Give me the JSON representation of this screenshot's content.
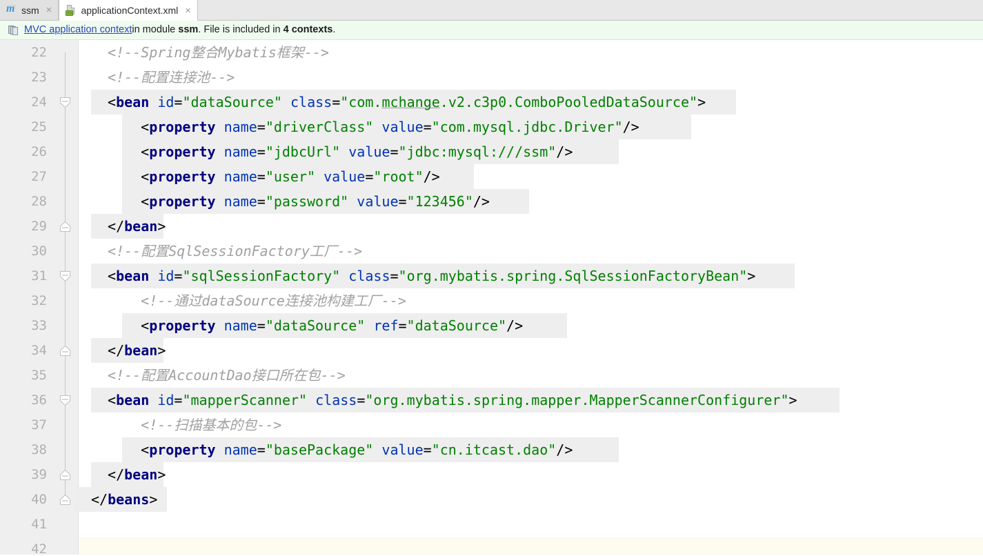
{
  "window": {
    "tabs": [
      {
        "label": "ssm",
        "icon": "module-icon",
        "active": false,
        "closable": true
      },
      {
        "label": "applicationContext.xml",
        "icon": "xml-file-icon",
        "active": true,
        "closable": true
      }
    ],
    "close_glyph": "×"
  },
  "notification": {
    "icon": "contexts-icon",
    "link_text": "MVC application context",
    "text_mid_1": "in module ",
    "module_name": "ssm",
    "text_mid_2": ". File is included in ",
    "context_count": "4 contexts",
    "text_end": ".",
    "background_color": "#effbef",
    "link_color": "#2648b8"
  },
  "editor": {
    "colors": {
      "tag": "#000080",
      "attribute": "#0033b3",
      "value": "#008000",
      "comment": "#a0a0a0",
      "highlight_background": "#eeeeee",
      "current_line_background": "#fefbef",
      "gutter_background": "#efefef",
      "line_number_color": "#b0b0b0"
    },
    "first_line_number": 22,
    "line_height": 36,
    "lines": [
      {
        "num": 22,
        "indent": 2,
        "fold": null,
        "highlight": false,
        "tokens": [
          {
            "t": "comment",
            "s": "<!--Spring整合Mybatis框架-->"
          }
        ]
      },
      {
        "num": 23,
        "indent": 2,
        "fold": null,
        "highlight": false,
        "tokens": [
          {
            "t": "comment",
            "s": "<!--配置连接池-->"
          }
        ]
      },
      {
        "num": 24,
        "indent": 2,
        "fold": "open-start",
        "highlight": true,
        "hl_width": 935,
        "tokens": [
          {
            "t": "punct",
            "s": "<"
          },
          {
            "t": "tag",
            "s": "bean"
          },
          {
            "t": "plain",
            "s": " "
          },
          {
            "t": "attr",
            "s": "id"
          },
          {
            "t": "punct",
            "s": "="
          },
          {
            "t": "val",
            "s": "\"dataSource\""
          },
          {
            "t": "plain",
            "s": " "
          },
          {
            "t": "attr",
            "s": "class"
          },
          {
            "t": "punct",
            "s": "="
          },
          {
            "t": "val",
            "s": "\"com."
          },
          {
            "t": "val-spell",
            "s": "mchange"
          },
          {
            "t": "val",
            "s": ".v2.c3p0.ComboPooledDataSource\""
          },
          {
            "t": "punct",
            "s": ">"
          }
        ]
      },
      {
        "num": 25,
        "indent": 6,
        "fold": null,
        "highlight": true,
        "hl_off": 45,
        "hl_width": 825,
        "tokens": [
          {
            "t": "punct",
            "s": "<"
          },
          {
            "t": "tag",
            "s": "property"
          },
          {
            "t": "plain",
            "s": " "
          },
          {
            "t": "attr",
            "s": "name"
          },
          {
            "t": "punct",
            "s": "="
          },
          {
            "t": "val",
            "s": "\"driverClass\""
          },
          {
            "t": "plain",
            "s": " "
          },
          {
            "t": "attr",
            "s": "value"
          },
          {
            "t": "punct",
            "s": "="
          },
          {
            "t": "val",
            "s": "\"com.mysql.jdbc.Driver\""
          },
          {
            "t": "punct",
            "s": "/>"
          }
        ]
      },
      {
        "num": 26,
        "indent": 6,
        "fold": null,
        "highlight": true,
        "hl_off": 45,
        "hl_width": 720,
        "tokens": [
          {
            "t": "punct",
            "s": "<"
          },
          {
            "t": "tag",
            "s": "property"
          },
          {
            "t": "plain",
            "s": " "
          },
          {
            "t": "attr",
            "s": "name"
          },
          {
            "t": "punct",
            "s": "="
          },
          {
            "t": "val",
            "s": "\"jdbcUrl\""
          },
          {
            "t": "plain",
            "s": " "
          },
          {
            "t": "attr",
            "s": "value"
          },
          {
            "t": "punct",
            "s": "="
          },
          {
            "t": "val",
            "s": "\"jdbc:mysql:///ssm\""
          },
          {
            "t": "punct",
            "s": "/>"
          }
        ]
      },
      {
        "num": 27,
        "indent": 6,
        "fold": null,
        "highlight": true,
        "hl_off": 45,
        "hl_width": 510,
        "tokens": [
          {
            "t": "punct",
            "s": "<"
          },
          {
            "t": "tag",
            "s": "property"
          },
          {
            "t": "plain",
            "s": " "
          },
          {
            "t": "attr",
            "s": "name"
          },
          {
            "t": "punct",
            "s": "="
          },
          {
            "t": "val",
            "s": "\"user\""
          },
          {
            "t": "plain",
            "s": " "
          },
          {
            "t": "attr",
            "s": "value"
          },
          {
            "t": "punct",
            "s": "="
          },
          {
            "t": "val",
            "s": "\"root\""
          },
          {
            "t": "punct",
            "s": "/>"
          }
        ]
      },
      {
        "num": 28,
        "indent": 6,
        "fold": null,
        "highlight": true,
        "hl_off": 45,
        "hl_width": 590,
        "tokens": [
          {
            "t": "punct",
            "s": "<"
          },
          {
            "t": "tag",
            "s": "property"
          },
          {
            "t": "plain",
            "s": " "
          },
          {
            "t": "attr",
            "s": "name"
          },
          {
            "t": "punct",
            "s": "="
          },
          {
            "t": "val",
            "s": "\"password\""
          },
          {
            "t": "plain",
            "s": " "
          },
          {
            "t": "attr",
            "s": "value"
          },
          {
            "t": "punct",
            "s": "="
          },
          {
            "t": "val",
            "s": "\"123456\""
          },
          {
            "t": "punct",
            "s": "/>"
          }
        ]
      },
      {
        "num": 29,
        "indent": 2,
        "fold": "open-end",
        "highlight": true,
        "hl_width": 105,
        "tokens": [
          {
            "t": "punct",
            "s": "</"
          },
          {
            "t": "tag",
            "s": "bean"
          },
          {
            "t": "punct",
            "s": ">"
          }
        ]
      },
      {
        "num": 30,
        "indent": 2,
        "fold": null,
        "highlight": false,
        "tokens": [
          {
            "t": "comment",
            "s": "<!--配置SqlSessionFactory工厂-->"
          }
        ]
      },
      {
        "num": 31,
        "indent": 2,
        "fold": "open-start",
        "highlight": true,
        "hl_width": 1020,
        "tokens": [
          {
            "t": "punct",
            "s": "<"
          },
          {
            "t": "tag",
            "s": "bean"
          },
          {
            "t": "plain",
            "s": " "
          },
          {
            "t": "attr",
            "s": "id"
          },
          {
            "t": "punct",
            "s": "="
          },
          {
            "t": "val",
            "s": "\"sqlSessionFactory\""
          },
          {
            "t": "plain",
            "s": " "
          },
          {
            "t": "attr",
            "s": "class"
          },
          {
            "t": "punct",
            "s": "="
          },
          {
            "t": "val",
            "s": "\"org.mybatis.spring.SqlSessionFactoryBean\""
          },
          {
            "t": "punct",
            "s": ">"
          }
        ]
      },
      {
        "num": 32,
        "indent": 6,
        "fold": null,
        "highlight": false,
        "tokens": [
          {
            "t": "comment",
            "s": "<!--通过dataSource连接池构建工厂-->"
          }
        ]
      },
      {
        "num": 33,
        "indent": 6,
        "fold": null,
        "highlight": true,
        "hl_off": 45,
        "hl_width": 645,
        "tokens": [
          {
            "t": "punct",
            "s": "<"
          },
          {
            "t": "tag",
            "s": "property"
          },
          {
            "t": "plain",
            "s": " "
          },
          {
            "t": "attr",
            "s": "name"
          },
          {
            "t": "punct",
            "s": "="
          },
          {
            "t": "val",
            "s": "\"dataSource\""
          },
          {
            "t": "plain",
            "s": " "
          },
          {
            "t": "attr",
            "s": "ref"
          },
          {
            "t": "punct",
            "s": "="
          },
          {
            "t": "val",
            "s": "\"dataSource\""
          },
          {
            "t": "punct",
            "s": "/>"
          }
        ]
      },
      {
        "num": 34,
        "indent": 2,
        "fold": "open-end",
        "highlight": true,
        "hl_width": 105,
        "tokens": [
          {
            "t": "punct",
            "s": "</"
          },
          {
            "t": "tag",
            "s": "bean"
          },
          {
            "t": "punct",
            "s": ">"
          }
        ]
      },
      {
        "num": 35,
        "indent": 2,
        "fold": null,
        "highlight": false,
        "tokens": [
          {
            "t": "comment",
            "s": "<!--配置AccountDao接口所在包-->"
          }
        ]
      },
      {
        "num": 36,
        "indent": 2,
        "fold": "open-start",
        "highlight": true,
        "hl_width": 1085,
        "tokens": [
          {
            "t": "punct",
            "s": "<"
          },
          {
            "t": "tag",
            "s": "bean"
          },
          {
            "t": "plain",
            "s": " "
          },
          {
            "t": "attr",
            "s": "id"
          },
          {
            "t": "punct",
            "s": "="
          },
          {
            "t": "val",
            "s": "\"mapperScanner\""
          },
          {
            "t": "plain",
            "s": " "
          },
          {
            "t": "attr",
            "s": "class"
          },
          {
            "t": "punct",
            "s": "="
          },
          {
            "t": "val",
            "s": "\"org.mybatis.spring.mapper.MapperScannerConfigurer\""
          },
          {
            "t": "punct",
            "s": ">"
          }
        ]
      },
      {
        "num": 37,
        "indent": 6,
        "fold": null,
        "highlight": false,
        "tokens": [
          {
            "t": "comment",
            "s": "<!--扫描基本的包-->"
          }
        ]
      },
      {
        "num": 38,
        "indent": 6,
        "fold": null,
        "highlight": true,
        "hl_off": 45,
        "hl_width": 720,
        "tokens": [
          {
            "t": "punct",
            "s": "<"
          },
          {
            "t": "tag",
            "s": "property"
          },
          {
            "t": "plain",
            "s": " "
          },
          {
            "t": "attr",
            "s": "name"
          },
          {
            "t": "punct",
            "s": "="
          },
          {
            "t": "val",
            "s": "\"basePackage\""
          },
          {
            "t": "plain",
            "s": " "
          },
          {
            "t": "attr",
            "s": "value"
          },
          {
            "t": "punct",
            "s": "="
          },
          {
            "t": "val-spell2",
            "s": "\"cn.itcast.dao\""
          },
          {
            "t": "punct",
            "s": "/>"
          }
        ]
      },
      {
        "num": 39,
        "indent": 2,
        "fold": "open-end",
        "highlight": true,
        "hl_width": 105,
        "tokens": [
          {
            "t": "punct",
            "s": "</"
          },
          {
            "t": "tag",
            "s": "bean"
          },
          {
            "t": "punct",
            "s": ">"
          }
        ]
      },
      {
        "num": 40,
        "indent": 0,
        "fold": "open-end",
        "highlight": true,
        "hl_off": -25,
        "hl_width": 135,
        "tokens": [
          {
            "t": "punct",
            "s": "</"
          },
          {
            "t": "tag",
            "s": "beans"
          },
          {
            "t": "punct",
            "s": ">"
          }
        ]
      },
      {
        "num": 41,
        "indent": 0,
        "fold": null,
        "highlight": false,
        "tokens": []
      },
      {
        "num": 42,
        "indent": 0,
        "fold": null,
        "highlight": false,
        "current": true,
        "tokens": []
      }
    ]
  }
}
